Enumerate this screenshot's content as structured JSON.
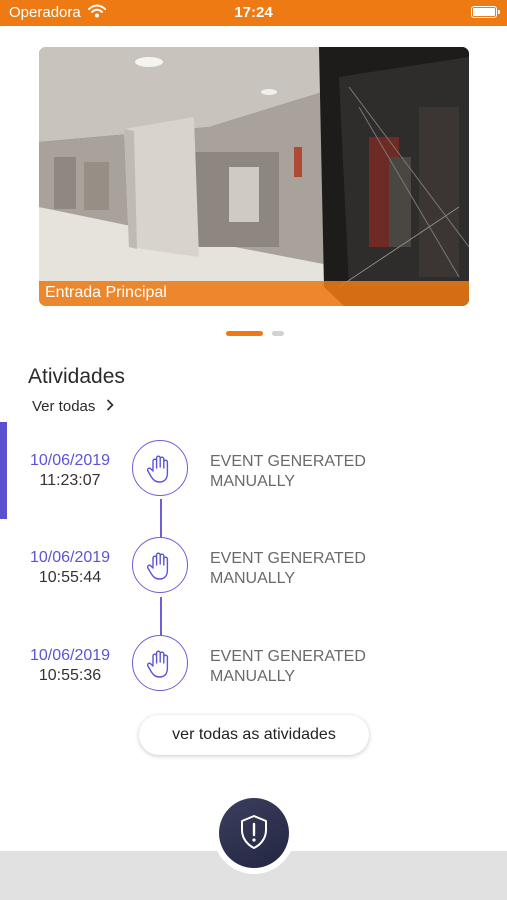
{
  "status_bar": {
    "carrier": "Operadora",
    "time": "17:24"
  },
  "camera": {
    "label": "Entrada Principal"
  },
  "pager": {
    "pages": 2,
    "active_index": 0
  },
  "activities": {
    "title": "Atividades",
    "see_all_label": "Ver todas",
    "items": [
      {
        "date": "10/06/2019",
        "time": "11:23:07",
        "description": "EVENT GENERATED MANUALLY"
      },
      {
        "date": "10/06/2019",
        "time": "10:55:44",
        "description": "EVENT GENERATED MANUALLY"
      },
      {
        "date": "10/06/2019",
        "time": "10:55:36",
        "description": "EVENT GENERATED MANUALLY"
      }
    ],
    "all_button_label": "ver todas as atividades"
  },
  "icons": {
    "activity": "hand-icon",
    "fab": "shield-alert-icon"
  },
  "colors": {
    "accent": "#ee7a14",
    "timeline": "#6b60d6",
    "date_text": "#5b54d8",
    "fab": "#2b2e4a"
  }
}
